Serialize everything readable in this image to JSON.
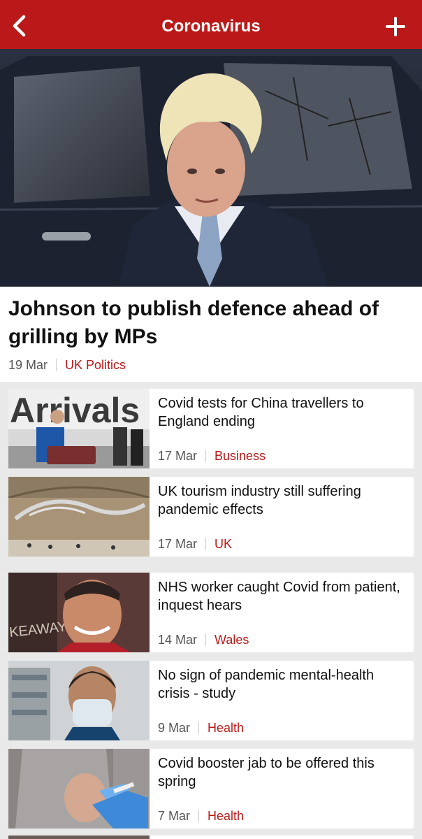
{
  "header": {
    "title": "Coronavirus",
    "color": "#bb1919"
  },
  "hero": {
    "headline": "Johnson to publish defence ahead of grilling by MPs",
    "date": "19 Mar",
    "category": "UK Politics"
  },
  "stories": [
    {
      "headline": "Covid tests for China travellers to England ending",
      "date": "17 Mar",
      "category": "Business",
      "image_text": "Arrivals"
    },
    {
      "headline": "UK tourism industry still suffering pandemic effects",
      "date": "17 Mar",
      "category": "UK"
    },
    {
      "headline": "NHS worker caught Covid from patient, inquest hears",
      "date": "14 Mar",
      "category": "Wales",
      "image_text": "KEAWAY"
    },
    {
      "headline": "No sign of pandemic mental-health crisis - study",
      "date": "9 Mar",
      "category": "Health"
    },
    {
      "headline": "Covid booster jab to be offered this spring",
      "date": "7 Mar",
      "category": "Health"
    }
  ]
}
